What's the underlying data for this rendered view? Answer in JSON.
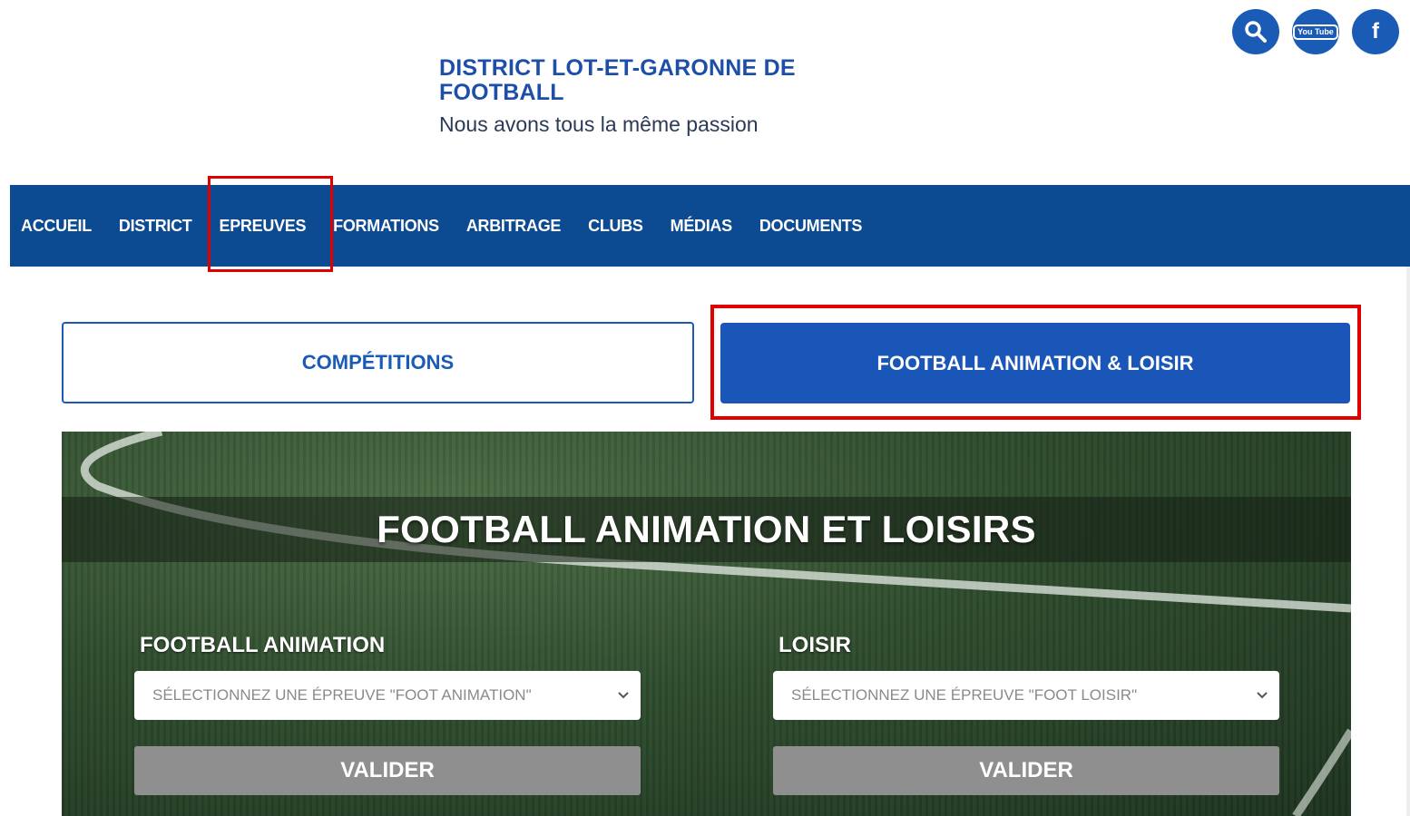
{
  "header": {
    "title": "DISTRICT LOT-ET-GARONNE DE FOOTBALL",
    "tagline": "Nous avons tous la même passion"
  },
  "social": {
    "youtube_text": "You Tube",
    "facebook_text": "f"
  },
  "nav": {
    "items": [
      {
        "label": "ACCUEIL"
      },
      {
        "label": "DISTRICT"
      },
      {
        "label": "EPREUVES"
      },
      {
        "label": "FORMATIONS"
      },
      {
        "label": "ARBITRAGE"
      },
      {
        "label": "CLUBS"
      },
      {
        "label": "MÉDIAS"
      },
      {
        "label": "DOCUMENTS"
      }
    ]
  },
  "tabs": {
    "competitions": "COMPÉTITIONS",
    "animation_loisir": "FOOTBALL ANIMATION & LOISIR"
  },
  "hero": {
    "title": "FOOTBALL ANIMATION ET LOISIRS",
    "left": {
      "label": "FOOTBALL ANIMATION",
      "select_placeholder": "SÉLECTIONNEZ UNE ÉPREUVE \"FOOT ANIMATION\"",
      "button": "VALIDER"
    },
    "right": {
      "label": "LOISIR",
      "select_placeholder": "SÉLECTIONNEZ UNE ÉPREUVE \"FOOT LOISIR\"",
      "button": "VALIDER"
    }
  },
  "colors": {
    "brand_blue": "#1a5cb5",
    "nav_blue": "#0c4a92",
    "highlight_red": "#e00000",
    "button_grey": "#8f8f8f"
  }
}
